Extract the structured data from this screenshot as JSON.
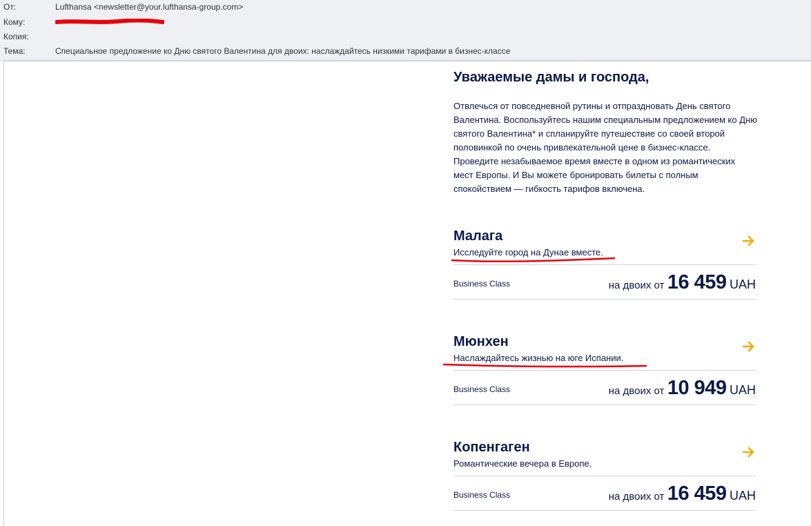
{
  "header": {
    "from_label": "От:",
    "from_value": "Lufthansa <newsletter@your.lufthansa-group.com>",
    "to_label": "Кому:",
    "cc_label": "Копия:",
    "subject_label": "Тема:",
    "subject_value": "Специальное предложение ко Дню святого Валентина для двоих: наслаждайтесь низкими тарифами в бизнес-классе"
  },
  "body": {
    "greeting": "Уважаемые дамы и господа,",
    "intro": "Отвлечься от повседневной рутины и отпраздновать День святого Валентина. Воспользуйтесь нашим специальным предложением ко Дню святого Валентина* и спланируйте путешествие со своей второй половинкой по очень привлекательной цене в бизнес-классе. Проведите незабываемое время вместе в одном из романтических мест Европы. И Вы можете бронировать билеты с полным спокойствием — гибкость тарифов включена."
  },
  "offers": [
    {
      "city": "Малага",
      "description": "Исследуйте город на Дунае вместе.",
      "class": "Business Class",
      "price_prefix": "на двоих от",
      "price": "16 459",
      "currency": "UAH",
      "arrow_icon": "arrow-right-icon"
    },
    {
      "city": "Мюнхен",
      "description": "Наслаждайтесь жизнью на юге Испании.",
      "class": "Business Class",
      "price_prefix": "на двоих от",
      "price": "10 949",
      "currency": "UAH",
      "arrow_icon": "arrow-right-icon"
    },
    {
      "city": "Копенгаген",
      "description": "Романтические вечера в Европе.",
      "class": "Business Class",
      "price_prefix": "на двоих от",
      "price": "16 459",
      "currency": "UAH",
      "arrow_icon": "arrow-right-icon"
    }
  ],
  "colors": {
    "text_dark_blue": "#0b1a48",
    "arrow_yellow": "#f5a800",
    "annotation_red": "#e8000c",
    "header_bg": "#eef0f3"
  }
}
